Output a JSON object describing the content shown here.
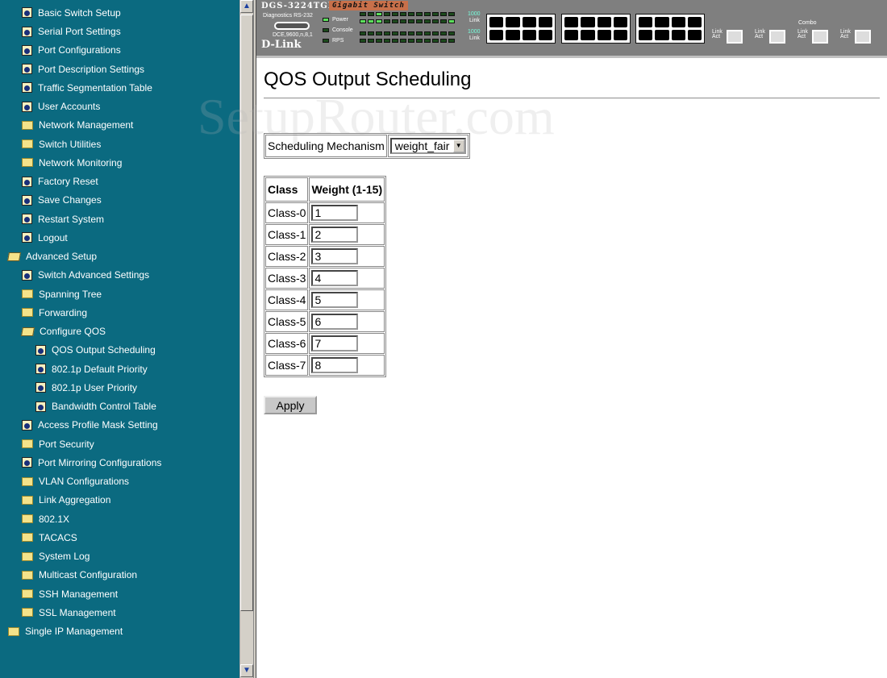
{
  "watermark": "SetupRouter.com",
  "sidebar": {
    "items": [
      {
        "label": "",
        "icon": "doc",
        "level": 1
      },
      {
        "label": "Basic Switch Setup",
        "icon": "doc",
        "level": 1
      },
      {
        "label": "Serial Port Settings",
        "icon": "doc",
        "level": 1
      },
      {
        "label": "Port Configurations",
        "icon": "doc",
        "level": 1
      },
      {
        "label": "Port Description Settings",
        "icon": "doc",
        "level": 1
      },
      {
        "label": "Traffic Segmentation Table",
        "icon": "doc",
        "level": 1
      },
      {
        "label": "User Accounts",
        "icon": "doc",
        "level": 1
      },
      {
        "label": "Network Management",
        "icon": "folder",
        "level": 1
      },
      {
        "label": "Switch Utilities",
        "icon": "folder",
        "level": 1
      },
      {
        "label": "Network Monitoring",
        "icon": "folder",
        "level": 1
      },
      {
        "label": "Factory Reset",
        "icon": "doc",
        "level": 1
      },
      {
        "label": "Save Changes",
        "icon": "doc",
        "level": 1
      },
      {
        "label": "Restart System",
        "icon": "doc",
        "level": 1
      },
      {
        "label": "Logout",
        "icon": "doc",
        "level": 1
      },
      {
        "label": "Advanced Setup",
        "icon": "open",
        "level": 0
      },
      {
        "label": "Switch Advanced Settings",
        "icon": "doc",
        "level": 1
      },
      {
        "label": "Spanning Tree",
        "icon": "folder",
        "level": 1
      },
      {
        "label": "Forwarding",
        "icon": "folder",
        "level": 1
      },
      {
        "label": "Configure QOS",
        "icon": "open",
        "level": 1
      },
      {
        "label": "QOS Output Scheduling",
        "icon": "doc",
        "level": 2
      },
      {
        "label": "802.1p Default Priority",
        "icon": "doc",
        "level": 2
      },
      {
        "label": "802.1p User Priority",
        "icon": "doc",
        "level": 2
      },
      {
        "label": "Bandwidth Control Table",
        "icon": "doc",
        "level": 2
      },
      {
        "label": "Access Profile Mask Setting",
        "icon": "doc",
        "level": 1
      },
      {
        "label": "Port Security",
        "icon": "folder",
        "level": 1
      },
      {
        "label": "Port Mirroring Configurations",
        "icon": "doc",
        "level": 1
      },
      {
        "label": "VLAN Configurations",
        "icon": "folder",
        "level": 1
      },
      {
        "label": "Link Aggregation",
        "icon": "folder",
        "level": 1
      },
      {
        "label": "802.1X",
        "icon": "folder",
        "level": 1
      },
      {
        "label": "TACACS",
        "icon": "folder",
        "level": 1
      },
      {
        "label": "System Log",
        "icon": "folder",
        "level": 1
      },
      {
        "label": "Multicast Configuration",
        "icon": "folder",
        "level": 1
      },
      {
        "label": "SSH Management",
        "icon": "folder",
        "level": 1
      },
      {
        "label": "SSL Management",
        "icon": "folder",
        "level": 1
      },
      {
        "label": "Single IP Management",
        "icon": "folder",
        "level": 0
      }
    ]
  },
  "device": {
    "model": "DGS-3224TGR",
    "tag": "Gigabit Switch",
    "diag": "Diagnostics RS-232",
    "serial": "DCE,9600,n,8,1",
    "brand": "D-Link",
    "leds": [
      "Power",
      "Console",
      "RPS"
    ],
    "combo": "Combo",
    "link": "Link",
    "act": "Act",
    "speed": "1000"
  },
  "page": {
    "title": "QOS Output Scheduling",
    "mechanism_label": "Scheduling Mechanism",
    "mechanism_value": "weight_fair",
    "col_class": "Class",
    "col_weight": "Weight (1-15)",
    "rows": [
      {
        "class": "Class-0",
        "weight": "1"
      },
      {
        "class": "Class-1",
        "weight": "2"
      },
      {
        "class": "Class-2",
        "weight": "3"
      },
      {
        "class": "Class-3",
        "weight": "4"
      },
      {
        "class": "Class-4",
        "weight": "5"
      },
      {
        "class": "Class-5",
        "weight": "6"
      },
      {
        "class": "Class-6",
        "weight": "7"
      },
      {
        "class": "Class-7",
        "weight": "8"
      }
    ],
    "apply_label": "Apply"
  }
}
